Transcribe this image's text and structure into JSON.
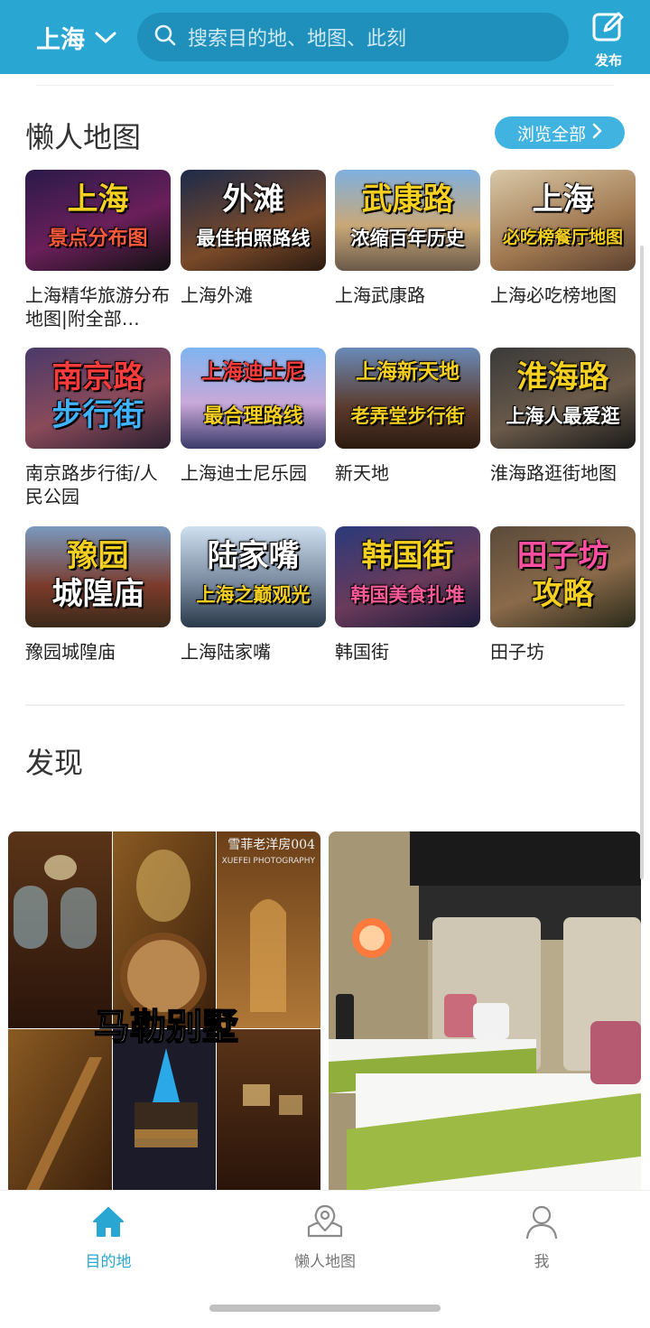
{
  "header": {
    "city": "上海",
    "search_placeholder": "搜索目的地、地图、此刻",
    "publish_label": "发布"
  },
  "lazy_map": {
    "title": "懒人地图",
    "browse_all": "浏览全部",
    "cards": [
      {
        "title": "上海精华旅游分布地图|附全部…",
        "thumb_line1": "上海",
        "thumb_line2": "景点分布图",
        "c1": "#f5d020",
        "c2": "#ff5a3c"
      },
      {
        "title": "上海外滩",
        "thumb_line1": "外滩",
        "thumb_line2": "最佳拍照路线",
        "c1": "#ffffff",
        "c2": "#ffffff"
      },
      {
        "title": "上海武康路",
        "thumb_line1": "武康路",
        "thumb_line2": "浓缩百年历史",
        "c1": "#f5d020",
        "c2": "#ffffff"
      },
      {
        "title": "上海必吃榜地图",
        "thumb_line1": "上海",
        "thumb_line2": "必吃榜餐厅地图",
        "c1": "#ffffff",
        "c2": "#f5d020"
      },
      {
        "title": "南京路步行街/人民公园",
        "thumb_line1": "南京路",
        "thumb_line2": "步行街",
        "c1": "#ff3b3b",
        "c2": "#3fb3ff"
      },
      {
        "title": "上海迪士尼乐园",
        "thumb_line1": "上海迪士尼",
        "thumb_line2": "最合理路线",
        "c1": "#ff3b3b",
        "c2": "#f5d020"
      },
      {
        "title": "新天地",
        "thumb_line1": "上海新天地",
        "thumb_line2": "老弄堂步行街",
        "c1": "#f5d020",
        "c2": "#f5d020"
      },
      {
        "title": "淮海路逛街地图",
        "thumb_line1": "淮海路",
        "thumb_line2": "上海人最爱逛",
        "c1": "#f5d020",
        "c2": "#ffffff"
      },
      {
        "title": "豫园城隍庙",
        "thumb_line1": "豫园",
        "thumb_line2": "城隍庙",
        "c1": "#f5d020",
        "c2": "#ffffff"
      },
      {
        "title": "上海陆家嘴",
        "thumb_line1": "陆家嘴",
        "thumb_line2": "上海之巅观光",
        "c1": "#ffffff",
        "c2": "#f5d020"
      },
      {
        "title": "韩国街",
        "thumb_line1": "韩国街",
        "thumb_line2": "韩国美食扎堆",
        "c1": "#f5d020",
        "c2": "#ff5a9a"
      },
      {
        "title": "田子坊",
        "thumb_line1": "田子坊",
        "thumb_line2": "攻略",
        "c1": "#ff4fa0",
        "c2": "#f5d020"
      }
    ]
  },
  "discover": {
    "title": "发现",
    "post1_overlay": "马勒别墅",
    "post1_watermark": "雪菲老洋房004",
    "post1_watermark2": "XUEFEI PHOTOGRAPHY"
  },
  "tabbar": {
    "tabs": [
      {
        "label": "目的地"
      },
      {
        "label": "懒人地图"
      },
      {
        "label": "我"
      }
    ]
  },
  "colors": {
    "primary": "#2aa6d3",
    "button": "#40b3e0"
  }
}
